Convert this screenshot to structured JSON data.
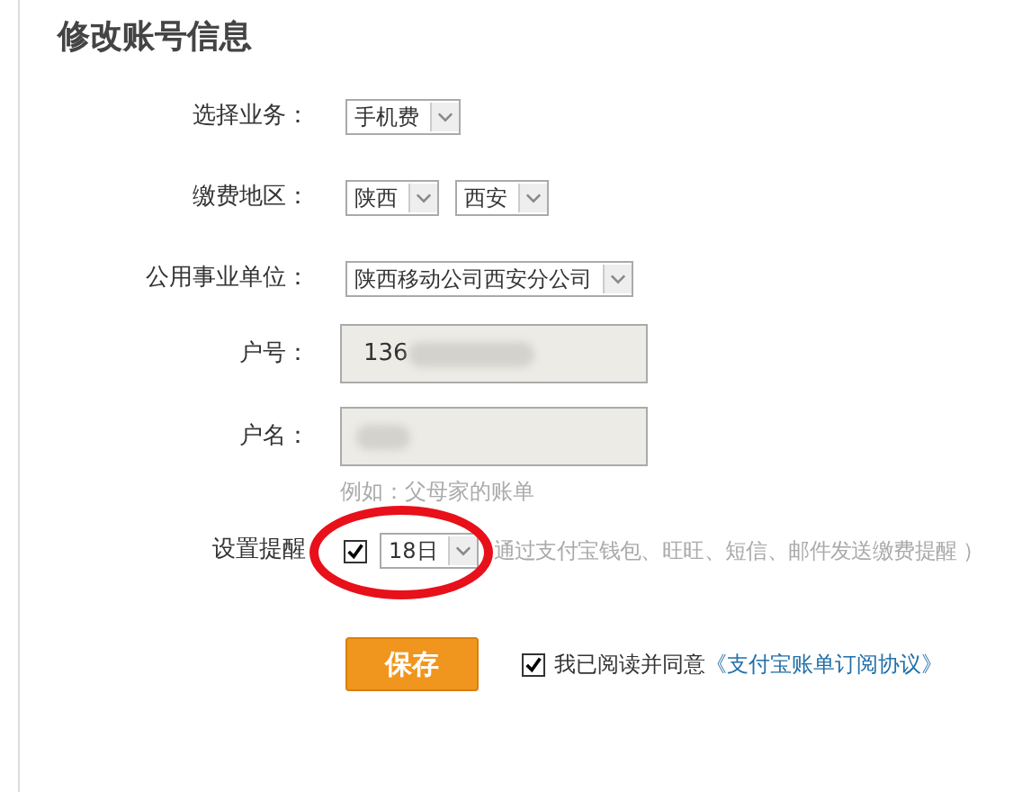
{
  "title": "修改账号信息",
  "rows": [
    {
      "kind": "select",
      "label": "选择业务：",
      "selects": [
        {
          "value": "手机费"
        }
      ]
    },
    {
      "kind": "select",
      "label": "缴费地区：",
      "selects": [
        {
          "value": "陕西"
        },
        {
          "value": "西安"
        }
      ]
    },
    {
      "kind": "select",
      "label": "公用事业单位：",
      "selects": [
        {
          "value": "陕西移动公司西安分公司"
        }
      ]
    },
    {
      "kind": "input",
      "label": "户号：",
      "value": "136",
      "blurred": true
    },
    {
      "kind": "input",
      "label": "户名：",
      "blurred": true,
      "hint": "例如：父母家的账单"
    },
    {
      "kind": "reminder",
      "label": "设置提醒",
      "checked": true,
      "day": "18日",
      "note": "通过支付宝钱包、旺旺、短信、邮件发送缴费提醒 ）"
    }
  ],
  "save_button": "保存",
  "agreement": {
    "checked": true,
    "text": "我已阅读并同意",
    "link": "《支付宝账单订阅协议》"
  }
}
